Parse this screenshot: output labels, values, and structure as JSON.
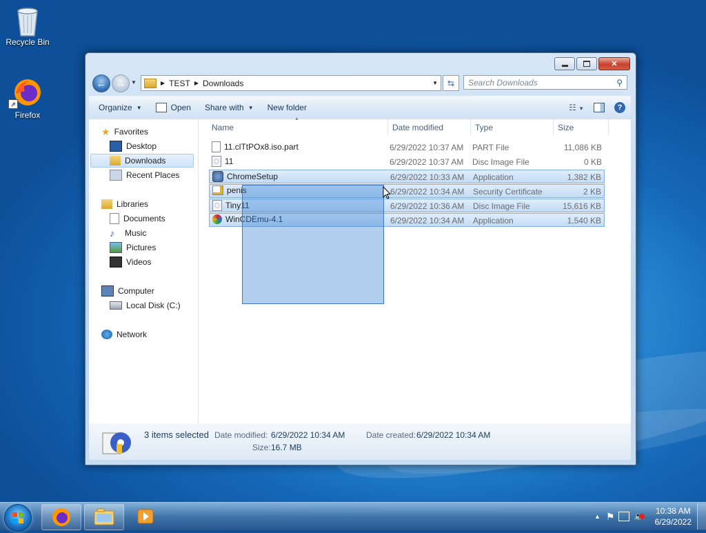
{
  "desktop": {
    "icons": [
      {
        "label": "Recycle Bin",
        "icon": "recycle-bin-icon"
      },
      {
        "label": "Firefox",
        "icon": "firefox-icon"
      }
    ]
  },
  "window": {
    "controls": {
      "minimize": "minimize",
      "maximize": "maximize",
      "close": "close"
    },
    "breadcrumb": [
      "TEST",
      "Downloads"
    ],
    "search_placeholder": "Search Downloads",
    "toolbar": {
      "organize": "Organize",
      "open": "Open",
      "share_with": "Share with",
      "new_folder": "New folder"
    },
    "nav": {
      "favorites": "Favorites",
      "desktop": "Desktop",
      "downloads": "Downloads",
      "recent_places": "Recent Places",
      "libraries": "Libraries",
      "documents": "Documents",
      "music": "Music",
      "pictures": "Pictures",
      "videos": "Videos",
      "computer": "Computer",
      "local_disk": "Local Disk (C:)",
      "network": "Network"
    },
    "columns": {
      "name": "Name",
      "date_modified": "Date modified",
      "type": "Type",
      "size": "Size"
    },
    "files": [
      {
        "name": "11.clTtPOx8.iso.part",
        "date": "6/29/2022 10:37 AM",
        "type": "PART File",
        "size": "11,086 KB",
        "selected": false,
        "icon": "document-icon"
      },
      {
        "name": "11",
        "date": "6/29/2022 10:37 AM",
        "type": "Disc Image File",
        "size": "0 KB",
        "selected": false,
        "icon": "disc-image-icon"
      },
      {
        "name": "ChromeSetup",
        "date": "6/29/2022 10:33 AM",
        "type": "Application",
        "size": "1,382 KB",
        "selected": true,
        "icon": "installer-icon"
      },
      {
        "name": "penis",
        "date": "6/29/2022 10:34 AM",
        "type": "Security Certificate",
        "size": "2 KB",
        "selected": true,
        "icon": "certificate-icon"
      },
      {
        "name": "Tiny11",
        "date": "6/29/2022 10:36 AM",
        "type": "Disc Image File",
        "size": "15,616 KB",
        "selected": true,
        "icon": "disc-image-icon"
      },
      {
        "name": "WinCDEmu-4.1",
        "date": "6/29/2022 10:34 AM",
        "type": "Application",
        "size": "1,540 KB",
        "selected": true,
        "icon": "application-icon"
      }
    ],
    "details": {
      "selection": "3 items selected",
      "date_modified_label": "Date modified:",
      "date_modified": "6/29/2022 10:34 AM",
      "date_created_label": "Date created:",
      "date_created": "6/29/2022 10:34 AM",
      "size_label": "Size:",
      "size": "16.7 MB"
    }
  },
  "taskbar": {
    "pinned": [
      "firefox-icon",
      "windows-explorer-icon",
      "media-player-icon"
    ],
    "clock_time": "10:38 AM",
    "clock_date": "6/29/2022"
  },
  "colors": {
    "selection": "#c4dcf5",
    "taskbar": "#3f78b0"
  }
}
